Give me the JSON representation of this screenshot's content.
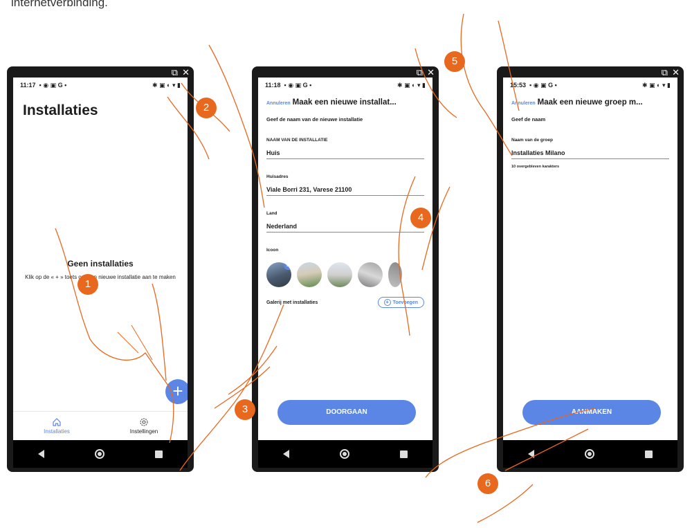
{
  "top_text": "internetverbinding.",
  "phone1": {
    "time": "11:17",
    "title": "Installaties",
    "empty_title": "Geen installaties",
    "empty_sub": "Klik op de « + » toets om een nieuwe installatie aan te maken",
    "fab_label": "+",
    "tabs": [
      {
        "label": "Installaties",
        "icon": "home-icon"
      },
      {
        "label": "Instellingen",
        "icon": "gear-icon"
      }
    ]
  },
  "phone2": {
    "time": "11:18",
    "cancel": "Annuleren",
    "title": "Maak een nieuwe installat...",
    "intro": "Geef de naam van de nieuwe installatie",
    "fields": [
      {
        "label": "NAAM VAN DE INSTALLATIE",
        "value": "Huis"
      },
      {
        "label": "Huisadres",
        "value": "Viale Borri 231, Varese 21100"
      },
      {
        "label": "Land",
        "value": "Nederland"
      }
    ],
    "icon_label": "Icoon",
    "gallery_label": "Galerij met installaties",
    "add_label": "Toevoegen",
    "continue_label": "DOORGAAN"
  },
  "phone3": {
    "time": "15:53",
    "cancel": "Annuleren",
    "title": "Maak een nieuwe groep m...",
    "intro": "Geef de naam",
    "field_label": "Naam van de groep",
    "field_value": "Installaties Milano",
    "helper": "10 overgebleven karakters",
    "create_label": "AANMAKEN"
  },
  "markers": [
    "1",
    "2",
    "3",
    "4",
    "5",
    "6"
  ],
  "colors": {
    "accent": "#5b86e5",
    "marker": "#e8681e"
  }
}
